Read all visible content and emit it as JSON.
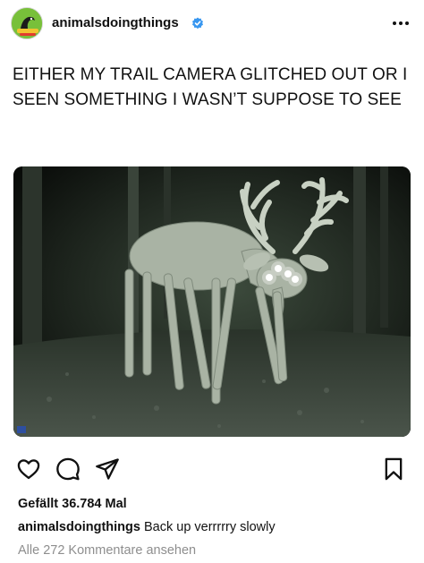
{
  "post": {
    "username": "animalsdoingthings",
    "more_icon": "more-horizontal-icon",
    "caption": "EITHER MY TRAIL CAMERA GLITCHED OUT OR I SEEN SOMETHING I WASN’T SUPPOSE TO SEE",
    "image_description_icon": "trail-camera-deer-photo",
    "likes_text": "Gefällt 36.784 Mal",
    "comment": {
      "username": "animalsdoingthings",
      "text": "Back up verrrrry slowly"
    },
    "view_comments": "Alle 272 Kommentare ansehen"
  },
  "colors": {
    "verified_badge": "#3897f0",
    "text": "#111111",
    "muted": "#8e8e8e",
    "avatar_bg": "#7cc23a"
  },
  "icons": [
    "heart-icon",
    "comment-icon",
    "share-icon",
    "bookmark-icon",
    "verified-badge-icon"
  ]
}
